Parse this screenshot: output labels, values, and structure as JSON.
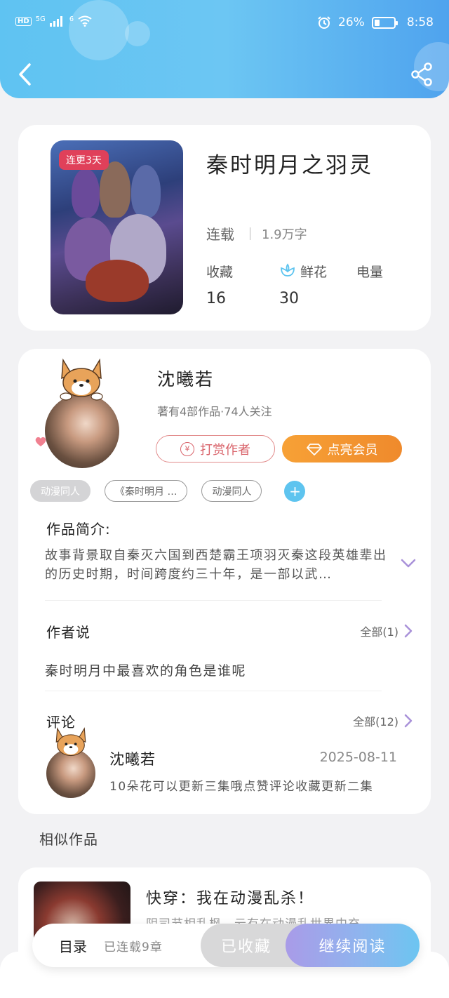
{
  "status_bar": {
    "hd": "HD",
    "network": "5G",
    "wifi_label": "6",
    "battery": "26%",
    "battery_level": 0.26,
    "time": "8:58"
  },
  "book": {
    "badge": "连更3天",
    "title": "秦时明月之羽灵",
    "status": "连载",
    "word_count": "1.9万字",
    "stats": [
      {
        "label": "收藏",
        "value": "16"
      },
      {
        "label": "鲜花",
        "value": "30"
      },
      {
        "label": "电量",
        "value": ""
      }
    ]
  },
  "author": {
    "name": "沈曦若",
    "meta": "著有4部作品·74人关注",
    "tip_label": "打赏作者",
    "vip_label": "点亮会员"
  },
  "tags": [
    "动漫同人",
    "《秦时明月 …",
    "动漫同人"
  ],
  "intro": {
    "title": "作品简介:",
    "text": "故事背景取自秦灭六国到西楚霸王项羽灭秦这段英雄辈出的历史时期，时间跨度约三十年，是一部以武…"
  },
  "author_says": {
    "title": "作者说",
    "all_label": "全部(1)",
    "text": "秦时明月中最喜欢的角色是谁呢"
  },
  "comments": {
    "title": "评论",
    "all_label": "全部(12)",
    "items": [
      {
        "name": "沈曦若",
        "date": "2025-08-11",
        "text": "10朵花可以更新三集哦点赞评论收藏更新二集"
      }
    ]
  },
  "similar": {
    "title": "相似作品",
    "items": [
      {
        "title": "快穿：我在动漫乱杀！",
        "subtitle": "阴司节相乱枫，云有在动漫乱世界中充"
      }
    ]
  },
  "bottom_bar": {
    "toc_label": "目录",
    "chapters": "已连载9章",
    "fav_label": "已收藏",
    "read_label": "继续阅读"
  },
  "colors": {
    "header_start": "#5fc3f2",
    "header_end": "#4fa3ee",
    "badge": "#e0405a",
    "vip": "#f7a136",
    "tip": "#d9646b",
    "link_arrow": "#a991d9"
  }
}
